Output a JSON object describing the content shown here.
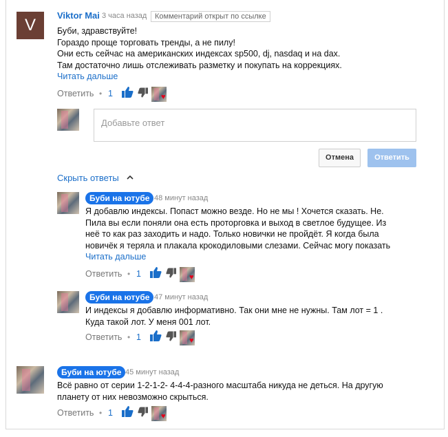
{
  "comment": {
    "author": "Viktor Mai",
    "avatar_letter": "V",
    "time": "3 часа назад",
    "badge": "Комментарий открыт по ссылке",
    "lines": [
      "Буби, здравствуйте!",
      "Гораздо проще торговать тренды, а не пилу!",
      "Они есть сейчас на американских индексах sp500, dj, nasdaq и на dax.",
      "Там достаточно лишь отслеживать разметку и покупать на коррекциях."
    ],
    "read_more": "Читать дальше",
    "reply_label": "Ответить",
    "separator": "•",
    "likes": "1"
  },
  "reply_form": {
    "placeholder": "Добавьте ответ",
    "cancel": "Отмена",
    "submit": "Ответить"
  },
  "hide_replies": "Скрыть ответы",
  "replies": [
    {
      "author": "Буби на ютубе",
      "time": "48 минут назад",
      "lines": [
        "Я добавлю индексы. Попаст можно везде. Но не мы ! Хочется сказать. Не.",
        "Пила вы если поняли она есть проторговка и выход в светлое будущее. Из",
        "неё то как раз заходить и надо. Только новички не пройдёт. Я когда была",
        "новичёк я теряла и плакала крокодиловыми слезами. Сейчас могу показать"
      ],
      "read_more": "Читать дальше",
      "reply_label": "Ответить",
      "likes": "1"
    },
    {
      "author": "Буби на ютубе",
      "time": "47 минут назад",
      "lines": [
        "И индексы я добавлю информативно. Так они мне не нужны. Там лот = 1 .",
        "Куда такой лот. У меня 001 лот."
      ],
      "reply_label": "Ответить",
      "likes": "1"
    }
  ],
  "bottom_comment": {
    "author": "Буби на ютубе",
    "time": "45 минут назад",
    "lines": [
      "Всё равно от серии 1-2-1-2- 4-4-4-разного масштаба никуда не деться. На другую",
      "планету от них невозможно скрыться."
    ],
    "reply_label": "Ответить",
    "likes": "1"
  },
  "colors": {
    "link": "#1a6ec9",
    "chip": "#1a73e8",
    "heart": "#e0001b",
    "submit_disabled": "#9ec2ee"
  }
}
